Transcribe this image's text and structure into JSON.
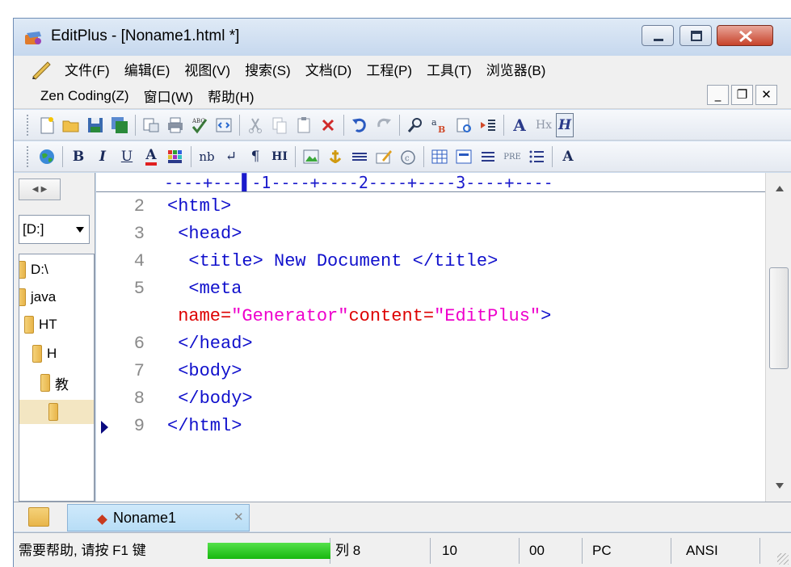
{
  "window": {
    "title": "EditPlus - [Noname1.html *]",
    "close_symbol": "✕"
  },
  "menu": {
    "row1": [
      "文件(F)",
      "编辑(E)",
      "视图(V)",
      "搜索(S)",
      "文档(D)",
      "工程(P)",
      "工具(T)",
      "浏览器(B)"
    ],
    "row2": [
      "Zen Coding(Z)",
      "窗口(W)",
      "帮助(H)"
    ],
    "mdi": {
      "minimize": "_",
      "restore": "❐",
      "close": "✕"
    }
  },
  "toolbar2": {
    "bold": "B",
    "italic": "I",
    "underline": "U",
    "font_color": "A",
    "nbsp": "nb",
    "break": "↵",
    "paragraph": "¶",
    "heading": "HI",
    "pre": "PRE",
    "more": "A"
  },
  "toolbar1": {
    "font_size": "A",
    "hx": "Hx"
  },
  "left_panel": {
    "drive": "[D:]",
    "tree": [
      {
        "label": "D:\\"
      },
      {
        "label": "java"
      },
      {
        "label": "HT"
      },
      {
        "label": "H"
      },
      {
        "label": "教"
      },
      {
        "label": ""
      }
    ]
  },
  "editor": {
    "ruler": "----+---▌-1----+----2----+----3----+----",
    "lines": [
      {
        "num": "2",
        "code": "<html>"
      },
      {
        "num": "3",
        "code": " <head>"
      },
      {
        "num": "4",
        "code": "  <title> New Document </title>"
      },
      {
        "num": "5",
        "code": "  <meta"
      },
      {
        "num": "",
        "attr_name1": " name=",
        "attr_val1": "\"Generator\"",
        "attr_name2": "content=",
        "attr_val2": "\"EditPlus\"",
        "tail": ">"
      },
      {
        "num": "6",
        "code": " </head>"
      },
      {
        "num": "7",
        "code": " <body>"
      },
      {
        "num": "8",
        "code": " </body>"
      },
      {
        "num": "9",
        "code": "</html>"
      }
    ]
  },
  "tabs": [
    {
      "label": "Noname1"
    }
  ],
  "status": {
    "help": "需要帮助, 请按 F1 键",
    "progress": 1.0,
    "col": "列 8",
    "col_num": "10",
    "ins": "00",
    "eol": "PC",
    "encoding": "ANSI"
  },
  "colors": {
    "tag": "#1010cc",
    "attr_name": "#dd0000",
    "attr_value": "#ee00cc",
    "line_number": "#8a8a8a",
    "progress": "#17b80e"
  }
}
